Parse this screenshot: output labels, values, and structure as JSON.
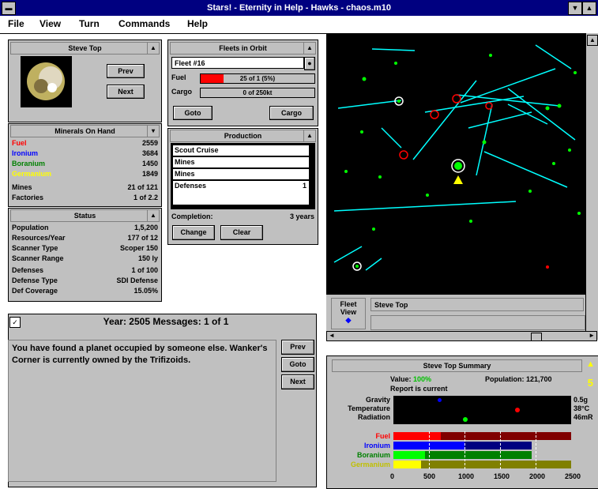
{
  "window": {
    "title": "Stars! - Eternity in Help - Hawks - chaos.m10"
  },
  "menu": [
    "File",
    "View",
    "Turn",
    "Commands",
    "Help"
  ],
  "planet_panel": {
    "title": "Steve Top",
    "prev_label": "Prev",
    "next_label": "Next"
  },
  "minerals": {
    "title": "Minerals On Hand",
    "rows": [
      {
        "label": "Fuel",
        "value": "2559",
        "color": "#ff0000"
      },
      {
        "label": "Ironium",
        "value": "3684",
        "color": "#0000ff"
      },
      {
        "label": "Boranium",
        "value": "1450",
        "color": "#008000"
      },
      {
        "label": "Germanium",
        "value": "1849",
        "color": "#ffff00"
      },
      {
        "label": "Mines",
        "value": "21 of 121",
        "color": "#000000"
      },
      {
        "label": "Factories",
        "value": "1 of 2.2",
        "color": "#000000"
      }
    ]
  },
  "status": {
    "title": "Status",
    "rows": [
      {
        "label": "Population",
        "value": "1,5,200"
      },
      {
        "label": "Resources/Year",
        "value": "177 of 12"
      },
      {
        "label": "Scanner Type",
        "value": "Scoper 150"
      },
      {
        "label": "Scanner Range",
        "value": "150 ly"
      },
      {
        "label": "Defenses",
        "value": "1 of 100"
      },
      {
        "label": "Defense Type",
        "value": "SDI Defense"
      },
      {
        "label": "Def Coverage",
        "value": "15.05%"
      }
    ]
  },
  "fleets": {
    "title": "Fleets in Orbit",
    "selected": "Fleet #16",
    "fuel_label": "Fuel",
    "fuel_value": "25 of 1 (5%)",
    "fuel_fraction": 0.2,
    "cargo_label": "Cargo",
    "cargo_value": "0 of 250kt",
    "goto_label": "Goto",
    "cargo_btn": "Cargo"
  },
  "production": {
    "title": "Production",
    "items": [
      {
        "name": "Scout Cruise",
        "count": "",
        "selected": true
      },
      {
        "name": "Mines",
        "count": ""
      },
      {
        "name": "Mines",
        "count": ""
      },
      {
        "name": "Defenses",
        "count": "1"
      }
    ],
    "completion_label": "Completion:",
    "completion_value": "3 years",
    "change_label": "Change",
    "clear_label": "Clear"
  },
  "map_footer": {
    "fleet_view": "Fleet View",
    "location": "Steve Top"
  },
  "messages": {
    "header": "Year: 2505    Messages: 1 of 1",
    "text": "You have found a planet occupied by someone else. Wanker's Corner is currently owned by the Trifizoids.",
    "btn1": "Prev",
    "btn2": "Goto",
    "btn3": "Next"
  },
  "summary": {
    "title": "Steve Top Summary",
    "value_label": "Value:",
    "value": "100%",
    "population_label": "Population:",
    "population": "121,700",
    "report": "Report is current",
    "habitat_labels": [
      "Gravity",
      "Temperature",
      "Radiation"
    ],
    "habitat_values": [
      "0.5g",
      "38°C",
      "46mR"
    ],
    "mineral_labels": [
      "Fuel",
      "Ironium",
      "Boranium",
      "Germanium"
    ],
    "mineral_colors": [
      "#ff0000",
      "#0000ff",
      "#00c000",
      "#ffff00"
    ],
    "axis_ticks": [
      "0",
      "500",
      "1000",
      "1500",
      "2000",
      "2500"
    ]
  }
}
